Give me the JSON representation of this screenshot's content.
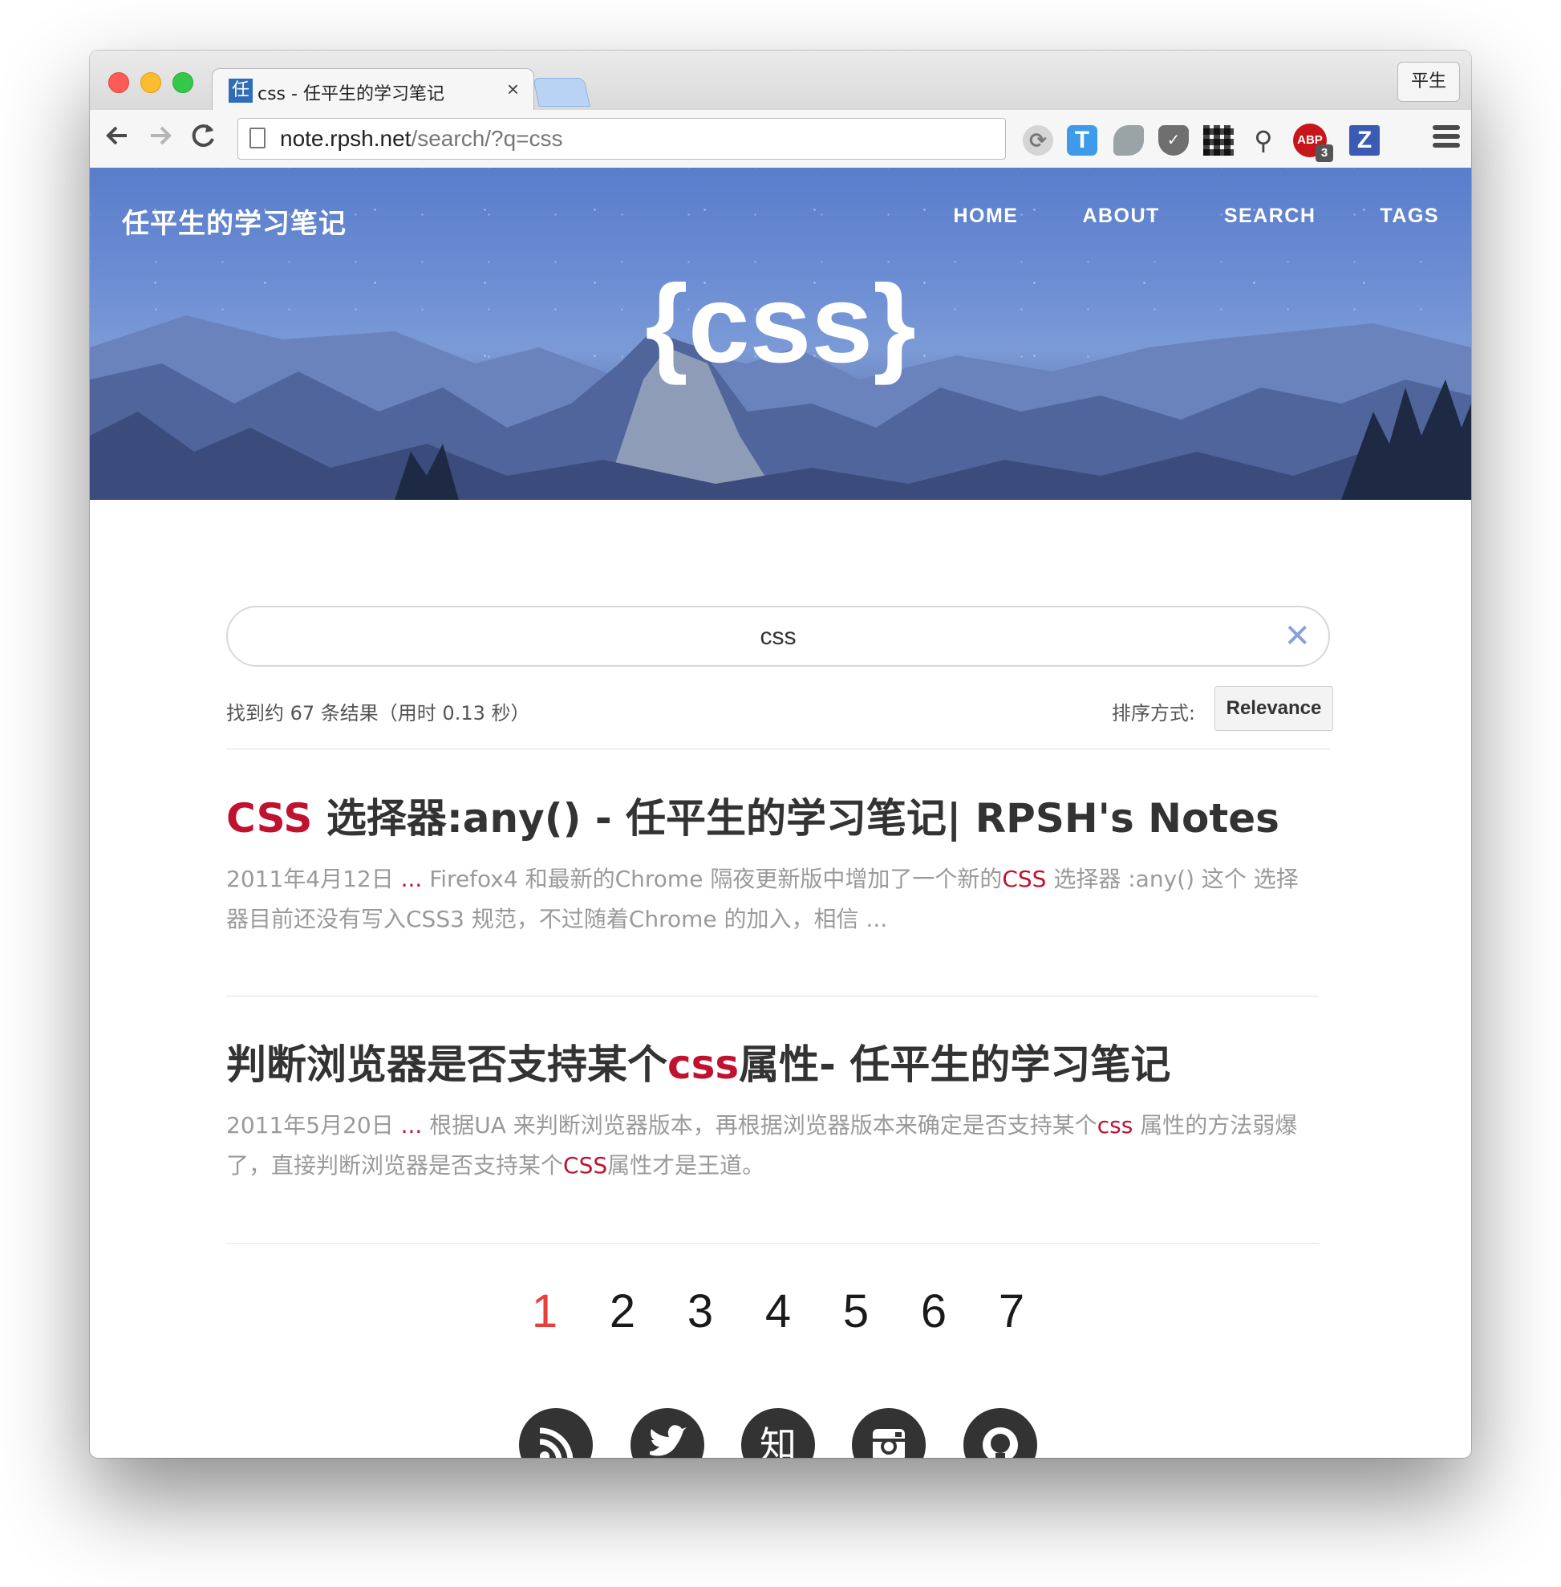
{
  "browser": {
    "tab_title": "css - 任平生的学习笔记",
    "tab_favicon": "任",
    "tab_close": "×",
    "profile": "平生",
    "url_host": "note.rpsh.net",
    "url_path": "/search/?q=css"
  },
  "site": {
    "title": "任平生的学习笔记",
    "nav": [
      "HOME",
      "ABOUT",
      "SEARCH",
      "TAGS"
    ],
    "hero_title": "{css}"
  },
  "search": {
    "query": "css",
    "clear_symbol": "✕",
    "stats": "找到约 67 条结果（用时 0.13 秒）",
    "sort_label": "排序方式:",
    "sort_value": "Relevance"
  },
  "results": [
    {
      "title_hl": "CSS",
      "title_rest": " 选择器:any() - 任平生的学习笔记| RPSH's Notes",
      "snippet_a": "2011年4月12日 ",
      "snippet_dots": "...",
      "snippet_b": " Firefox4 和最新的Chrome 隔夜更新版中增加了一个新的",
      "snippet_hl": "CSS",
      "snippet_c": " 选择器 :any() 这个 选择器目前还没有写入CSS3 规范，不过随着Chrome 的加入，相信 ..."
    },
    {
      "title_pre": "判断浏览器是否支持某个",
      "title_hl": "css",
      "title_post": "属性- 任平生的学习笔记",
      "snippet_a": "2011年5月20日 ",
      "snippet_dots": "...",
      "snippet_b": " 根据UA 来判断浏览器版本，再根据浏览器版本来确定是否支持某个",
      "snippet_hl": "css",
      "snippet_c": " 属性的方法弱爆了，直接判断浏览器是否支持某个",
      "snippet_hl2": "CSS",
      "snippet_d": "属性才是王道。"
    }
  ],
  "pagination": [
    "1",
    "2",
    "3",
    "4",
    "5",
    "6",
    "7"
  ],
  "pagination_current": "1",
  "social": [
    {
      "icon": "rss-icon",
      "glyph": "◉"
    },
    {
      "icon": "twitter-icon",
      "glyph": "🐦"
    },
    {
      "icon": "zhihu-icon",
      "glyph": "知"
    },
    {
      "icon": "instagram-icon",
      "glyph": "◎"
    },
    {
      "icon": "github-icon",
      "glyph": "●"
    }
  ],
  "colors": {
    "accent_red": "#c0112f",
    "pager_current": "#e4413a",
    "header_blue": "#6d8ed4"
  }
}
